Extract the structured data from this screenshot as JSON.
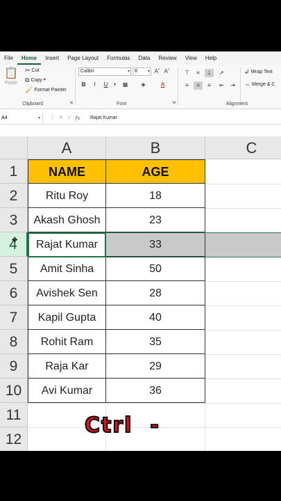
{
  "menu": [
    "File",
    "Home",
    "Insert",
    "Page Layout",
    "Formulas",
    "Data",
    "Review",
    "View",
    "Help"
  ],
  "menu_active": "Home",
  "ribbon": {
    "paste": "Paste",
    "cut": "Cut",
    "copy": "Copy",
    "format_painter": "Format Painter",
    "clipboard_label": "Clipboard",
    "font_name": "Calibri",
    "font_size": "8",
    "bold": "B",
    "italic": "I",
    "underline": "U",
    "font_label": "Font",
    "wrap_text": "Wrap Text",
    "merge": "Merge & C",
    "alignment_label": "Alignment"
  },
  "formula_bar": {
    "name_box": "A4",
    "fx": "fx",
    "content": "Rajat Kumar"
  },
  "columns": [
    "A",
    "B",
    "C"
  ],
  "rows": [
    "1",
    "2",
    "3",
    "4",
    "5",
    "6",
    "7",
    "8",
    "9",
    "10",
    "11",
    "12"
  ],
  "table": {
    "headers": [
      "NAME",
      "AGE"
    ],
    "names": [
      "Ritu Roy",
      "Akash Ghosh",
      "Rajat Kumar",
      "Amit Sinha",
      "Avishek Sen",
      "Kapil Gupta",
      "Rohit Ram",
      "Raja Kar",
      "Avi Kumar"
    ],
    "ages": [
      "18",
      "23",
      "33",
      "50",
      "28",
      "40",
      "35",
      "29",
      "36"
    ]
  },
  "overlay_text": "Ctrl  -",
  "colors": {
    "header_fill": "#ffc000",
    "excel_green": "#217346",
    "overlay_red": "#e8101e"
  }
}
